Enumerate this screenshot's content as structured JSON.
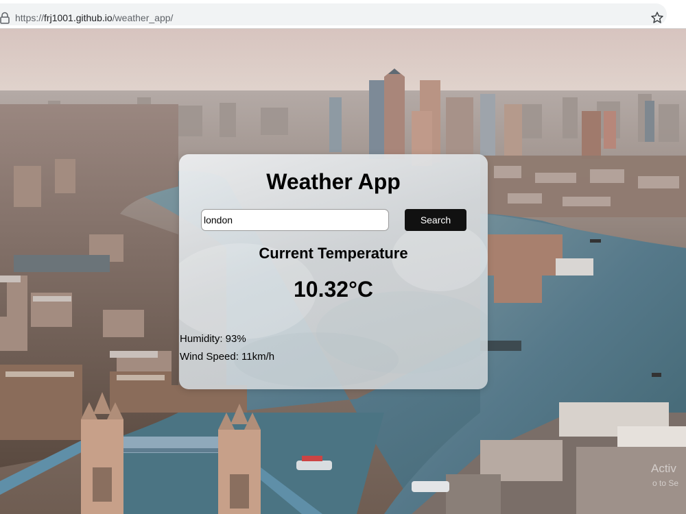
{
  "browser": {
    "url_scheme": "https://",
    "url_host": "frj1001.github.io",
    "url_path": "/weather_app/"
  },
  "app": {
    "title": "Weather App",
    "search": {
      "value": "london",
      "button_label": "Search"
    },
    "section_heading": "Current Temperature",
    "temperature": "10.32°C",
    "humidity": "Humidity: 93%",
    "wind_speed": "Wind Speed: 11km/h"
  },
  "watermark": {
    "line1": "Activ",
    "line2": "o to Se"
  },
  "colors": {
    "button_bg": "#111111",
    "button_text": "#ffffff",
    "river": "#4f7680",
    "sky": "#d9c8c2"
  },
  "icons": {
    "lock": "lock-icon",
    "bookmark": "star-icon"
  }
}
